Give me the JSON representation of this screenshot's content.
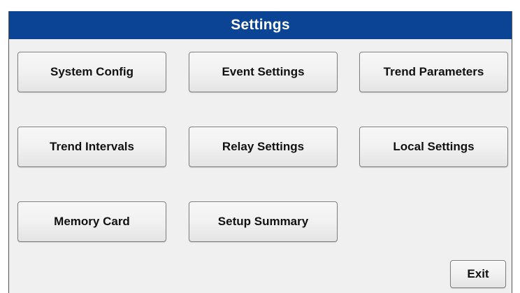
{
  "window": {
    "title": "Settings"
  },
  "buttons": {
    "system_config": "System Config",
    "event_settings": "Event Settings",
    "trend_parameters": "Trend Parameters",
    "trend_intervals": "Trend Intervals",
    "relay_settings": "Relay Settings",
    "local_settings": "Local Settings",
    "memory_card": "Memory Card",
    "setup_summary": "Setup Summary",
    "exit": "Exit"
  },
  "colors": {
    "title_bar": "#0b4494",
    "panel_background": "#f0f0f0",
    "button_border": "#7f7f7f"
  }
}
